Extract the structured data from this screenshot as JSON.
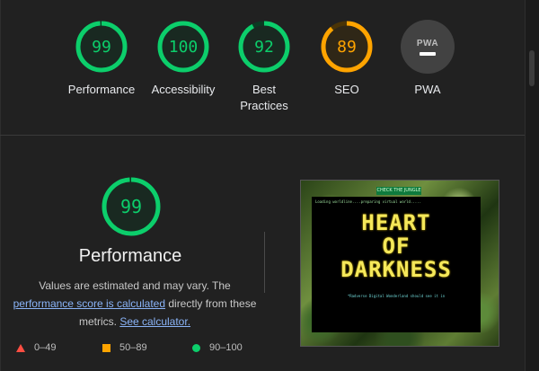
{
  "colors": {
    "pass": "#0cce6b",
    "pass_text": "#0cce6b",
    "pass_track": "#0b3a22",
    "average": "#ffa400",
    "average_track": "#4a3407",
    "fail": "#ff4e42",
    "pwa_bg": "#424242"
  },
  "summary": {
    "gauges": [
      {
        "score": "99",
        "label": "Performance",
        "color": "pass",
        "fraction": 0.99
      },
      {
        "score": "100",
        "label": "Accessibility",
        "color": "pass",
        "fraction": 1.0
      },
      {
        "score": "92",
        "label": "Best Practices",
        "color": "pass",
        "fraction": 0.92
      },
      {
        "score": "89",
        "label": "SEO",
        "color": "average",
        "fraction": 0.89
      }
    ],
    "pwa": {
      "badge_text": "PWA",
      "label": "PWA",
      "icon": "pwa-dash-icon"
    }
  },
  "detail": {
    "score": "99",
    "fraction": 0.99,
    "title": "Performance",
    "desc_part1": "Values are estimated and may vary. The",
    "link_score": "performance score is calculated",
    "desc_part2": " directly from these metrics. ",
    "link_calc": "See calculator."
  },
  "legend": {
    "fail": "0–49",
    "average": "50–89",
    "pass": "90–100"
  },
  "screenshot": {
    "button_text": "CHECK THE JUNGLE",
    "loading_text": "Loading worldline....preparing virtual world.....",
    "title_lines": [
      "HEART",
      "OF",
      "DARKNESS"
    ],
    "subline": "*Radverse Digital Wonderland should see it in"
  }
}
